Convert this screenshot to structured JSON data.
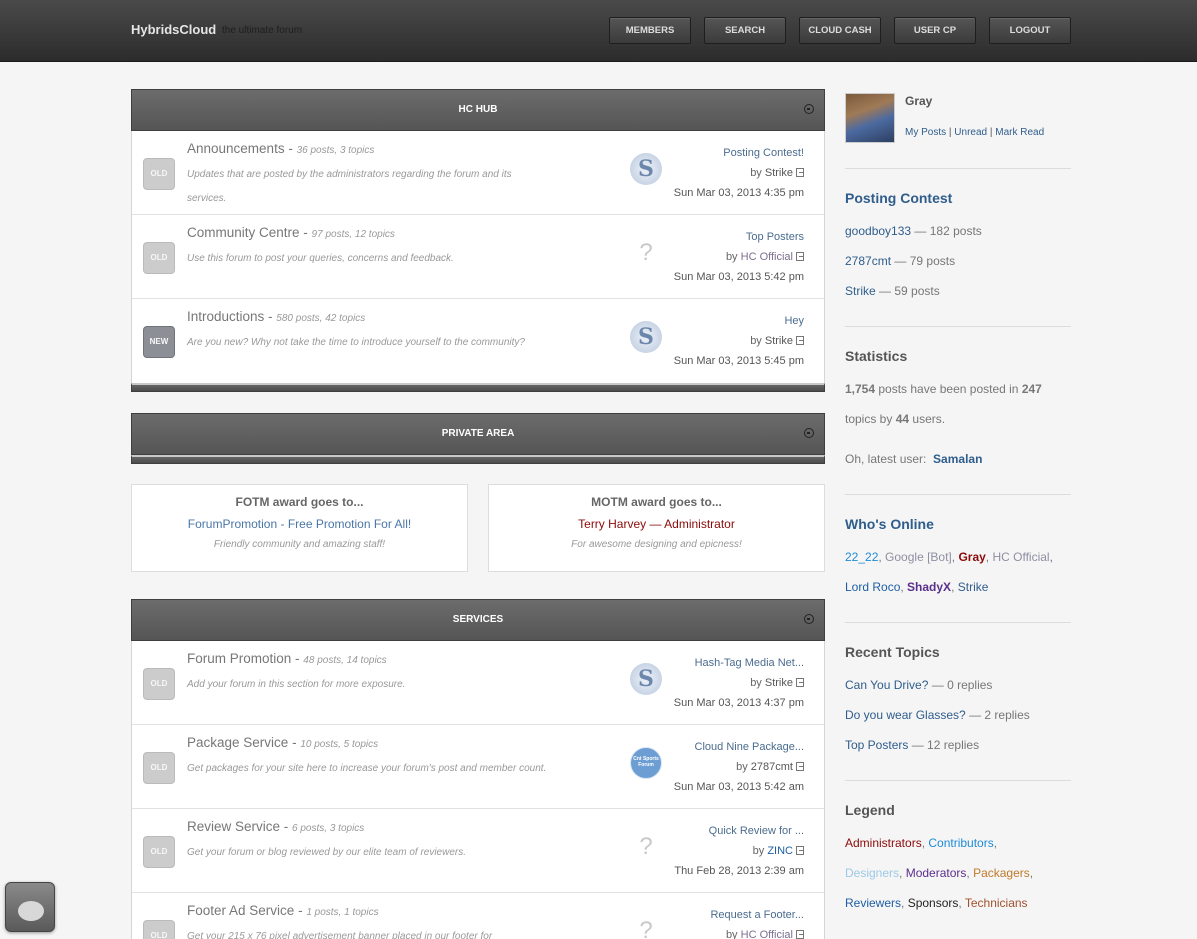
{
  "header": {
    "logo": "HybridsCloud",
    "tagline": "the ultimate forum",
    "nav": [
      "MEMBERS",
      "SEARCH",
      "CLOUD CASH",
      "USER CP",
      "LOGOUT"
    ]
  },
  "categories": [
    {
      "title": "HC HUB",
      "forums": [
        {
          "status": "OLD",
          "name": "Announcements",
          "meta": "36 posts, 3 topics",
          "desc": "Updates that are posted by the administrators regarding the forum and its services.",
          "avatar": "s",
          "last_title": "Posting Contest!",
          "by_label": "by",
          "last_by": "Strike",
          "last_date": "Sun Mar 03, 2013 4:35 pm"
        },
        {
          "status": "OLD",
          "name": "Community Centre",
          "meta": "97 posts, 12 topics",
          "desc": "Use this forum to post your queries, concerns and feedback.",
          "avatar": "q",
          "last_title": "Top Posters",
          "by_label": "by",
          "last_by": "HC Official",
          "last_date": "Sun Mar 03, 2013 5:42 pm"
        },
        {
          "status": "NEW",
          "name": "Introductions",
          "meta": "580 posts, 42 topics",
          "desc": "Are you new? Why not take the time to introduce yourself to the community?",
          "avatar": "s",
          "last_title": "Hey",
          "by_label": "by",
          "last_by": "Strike",
          "last_date": "Sun Mar 03, 2013 5:45 pm"
        }
      ]
    },
    {
      "title": "PRIVATE AREA",
      "forums": []
    },
    {
      "title": "SERVICES",
      "forums": [
        {
          "status": "OLD",
          "name": "Forum Promotion",
          "meta": "48 posts, 14 topics",
          "desc": "Add your forum in this section for more exposure.",
          "avatar": "s",
          "last_title": "Hash-Tag Media Net...",
          "by_label": "by",
          "last_by": "Strike",
          "last_date": "Sun Mar 03, 2013 4:37 pm"
        },
        {
          "status": "OLD",
          "name": "Package Service",
          "meta": "10 posts, 5 topics",
          "desc": "Get packages for your site here to increase your forum's post and member count.",
          "avatar": "b",
          "avatar_text": "Cnt Sports Forum",
          "last_title": "Cloud Nine Package...",
          "by_label": "by",
          "last_by": "2787cmt",
          "last_date": "Sun Mar 03, 2013 5:42 am"
        },
        {
          "status": "OLD",
          "name": "Review Service",
          "meta": "6 posts, 3 topics",
          "desc": "Get your forum or blog reviewed by our elite team of reviewers.",
          "avatar": "q",
          "last_title": "Quick Review for ...",
          "by_label": "by",
          "last_by": "ZINC",
          "last_date": "Thu Feb 28, 2013 2:39 am"
        },
        {
          "status": "OLD",
          "name": "Footer Ad Service",
          "meta": "1 posts, 1 topics",
          "desc": "Get your 215 x 76 pixel advertisement banner placed in our footer for",
          "avatar": "q",
          "last_title": "Request a Footer...",
          "by_label": "by",
          "last_by": "HC Official",
          "last_date": ""
        }
      ]
    }
  ],
  "awards": [
    {
      "heading": "FOTM award goes to...",
      "name": "ForumPromotion - Free Promotion For All!",
      "name_color": "#4a76a8",
      "desc": "Friendly community and amazing staff!"
    },
    {
      "heading": "MOTM award goes to...",
      "name": "Terry Harvey — Administrator",
      "name_color": "#8b0a0a",
      "desc": "For awesome designing and epicness!"
    }
  ],
  "sidebar": {
    "user": {
      "name": "Gray",
      "links": [
        "My Posts",
        "Unread",
        "Mark Read"
      ]
    },
    "posting_contest": {
      "title": "Posting Contest",
      "entries": [
        {
          "name": "goodboy133",
          "count": "— 182 posts"
        },
        {
          "name": "2787cmt",
          "count": "— 79 posts"
        },
        {
          "name": "Strike",
          "count": "— 59 posts"
        }
      ]
    },
    "statistics": {
      "title": "Statistics",
      "posts": "1,754",
      "t1": " posts have been posted in ",
      "topics": "247",
      "t2": "topics by ",
      "users": "44",
      "t3": " users.",
      "latest_label": "Oh, latest user:",
      "latest_user": "Samalan"
    },
    "whos_online": {
      "title": "Who's Online",
      "users": [
        {
          "name": "22_22",
          "color": "#1e8bd6",
          "bold": false
        },
        {
          "name": "Google [Bot]",
          "color": "#8f8fa3",
          "bold": false
        },
        {
          "name": "Gray",
          "color": "#8b0a0a",
          "bold": true
        },
        {
          "name": "HC Official",
          "color": "#8f8fa3",
          "bold": false
        },
        {
          "name": "Lord Roco",
          "color": "#1f5ea3",
          "bold": false
        },
        {
          "name": "ShadyX",
          "color": "#5b2f8c",
          "bold": true
        },
        {
          "name": "Strike",
          "color": "#2f5d8c",
          "bold": false
        }
      ]
    },
    "recent_topics": {
      "title": "Recent Topics",
      "items": [
        {
          "name": "Can You Drive?",
          "count": "— 0 replies"
        },
        {
          "name": "Do you wear Glasses?",
          "count": "— 2 replies"
        },
        {
          "name": "Top Posters",
          "count": "— 12 replies"
        }
      ]
    },
    "legend": {
      "title": "Legend",
      "groups": [
        {
          "name": "Administrators",
          "color": "#8b0a0a"
        },
        {
          "name": "Contributors",
          "color": "#1e8bd6"
        },
        {
          "name": "Designers",
          "color": "#9cc9e6"
        },
        {
          "name": "Moderators",
          "color": "#5b2f8c"
        },
        {
          "name": "Packagers",
          "color": "#c07a2a"
        },
        {
          "name": "Reviewers",
          "color": "#1f5ea3"
        },
        {
          "name": "Sponsors",
          "color": "#222222"
        },
        {
          "name": "Technicians",
          "color": "#a0522d"
        }
      ]
    }
  }
}
